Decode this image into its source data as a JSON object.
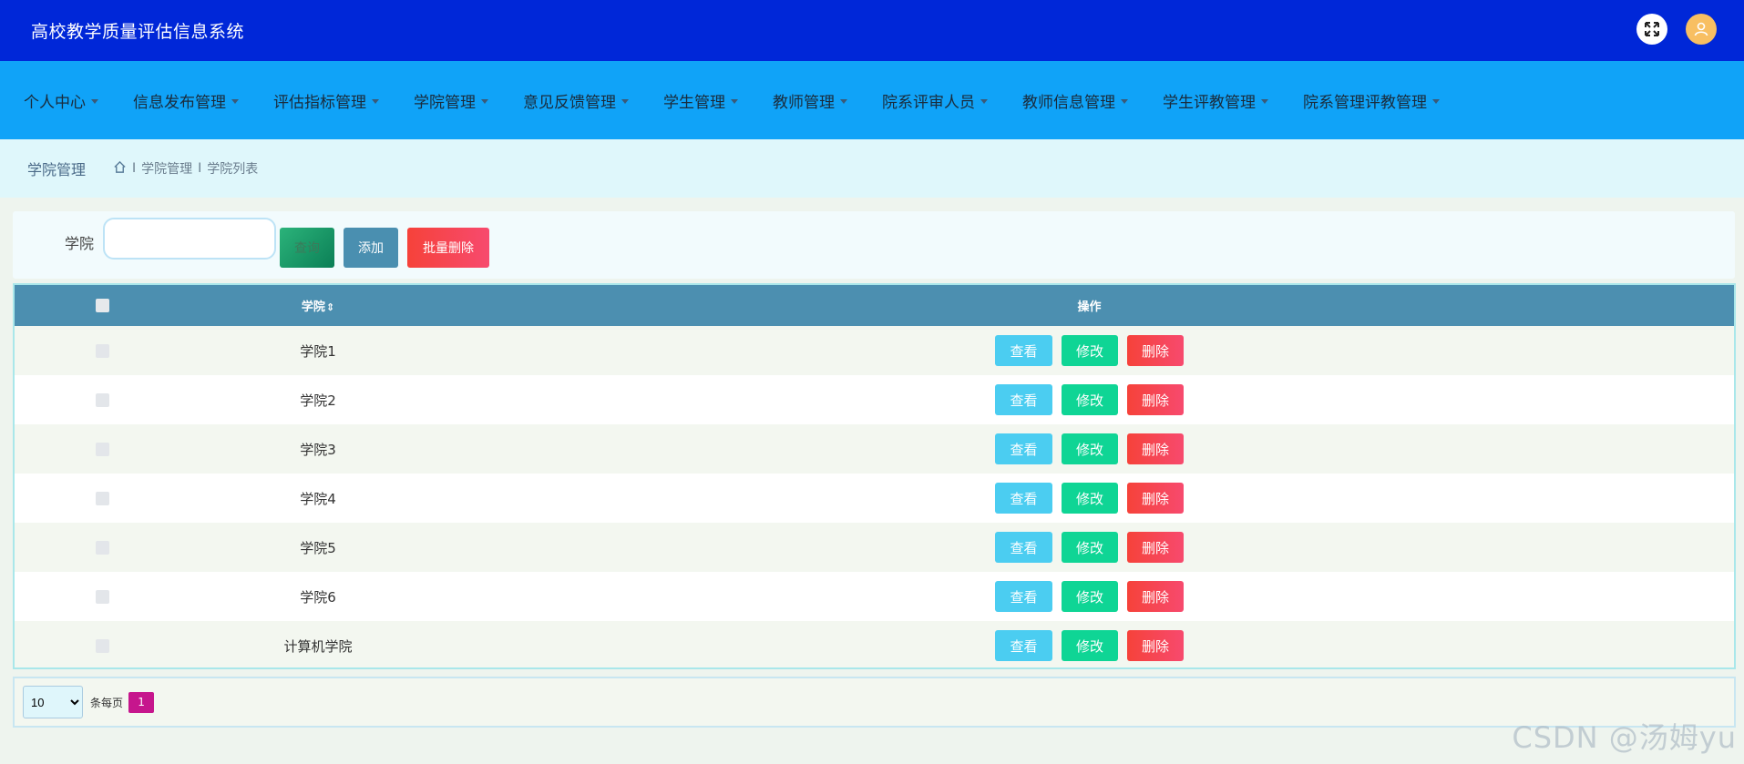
{
  "header": {
    "app_title": "高校教学质量评估信息系统",
    "icons": [
      "expand-icon",
      "user-avatar-icon"
    ],
    "colors": {
      "background": "#0027d8"
    }
  },
  "nav": {
    "items": [
      {
        "label": "个人中心"
      },
      {
        "label": "信息发布管理"
      },
      {
        "label": "评估指标管理"
      },
      {
        "label": "学院管理"
      },
      {
        "label": "意见反馈管理"
      },
      {
        "label": "学生管理"
      },
      {
        "label": "教师管理"
      },
      {
        "label": "院系评审人员"
      },
      {
        "label": "教师信息管理"
      },
      {
        "label": "学生评教管理"
      },
      {
        "label": "院系管理评教管理"
      }
    ],
    "colors": {
      "background": "#10a3f8"
    }
  },
  "breadcrumb": {
    "page_title": "学院管理",
    "home_icon": "home-icon",
    "separator": "I",
    "items": [
      "学院管理",
      "学院列表"
    ]
  },
  "search": {
    "label": "学院",
    "value": "",
    "placeholder": "",
    "query_label": "查询",
    "add_label": "添加",
    "batch_delete_label": "批量删除"
  },
  "table": {
    "columns": {
      "name": "学院",
      "ops": "操作"
    },
    "sort_icon": "⇕",
    "rows": [
      {
        "name": "学院1"
      },
      {
        "name": "学院2"
      },
      {
        "name": "学院3"
      },
      {
        "name": "学院4"
      },
      {
        "name": "学院5"
      },
      {
        "name": "学院6"
      },
      {
        "name": "计算机学院"
      }
    ],
    "ops": {
      "view": "查看",
      "edit": "修改",
      "delete": "删除"
    }
  },
  "pager": {
    "page_size": "10",
    "page_size_options": [
      "10"
    ],
    "per_page_label": "条每页",
    "current_page": "1"
  },
  "watermark": "CSDN @汤姆yu"
}
